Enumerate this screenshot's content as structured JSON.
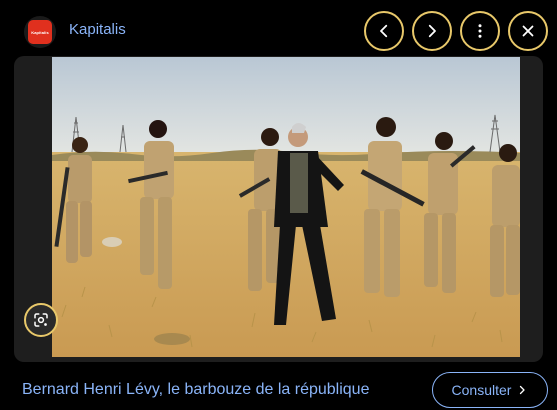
{
  "source": {
    "logo_text": "Kapitalis",
    "name": "Kapitalis"
  },
  "controls": {
    "previous_icon": "chevron-left-icon",
    "next_icon": "chevron-right-icon",
    "more_icon": "more-vertical-icon",
    "close_icon": "close-icon"
  },
  "image": {
    "description_icon": "image-photo"
  },
  "lens": {
    "icon": "lens-search-icon"
  },
  "caption": {
    "title": "Bernard Henri Lévy, le barbouze de la république"
  },
  "visit": {
    "label": "Consulter",
    "icon": "chevron-right-icon"
  },
  "colors": {
    "link_blue": "#8ab4f8",
    "control_border": "#e8c86a",
    "background": "#000000",
    "logo_red": "#e0301e"
  }
}
